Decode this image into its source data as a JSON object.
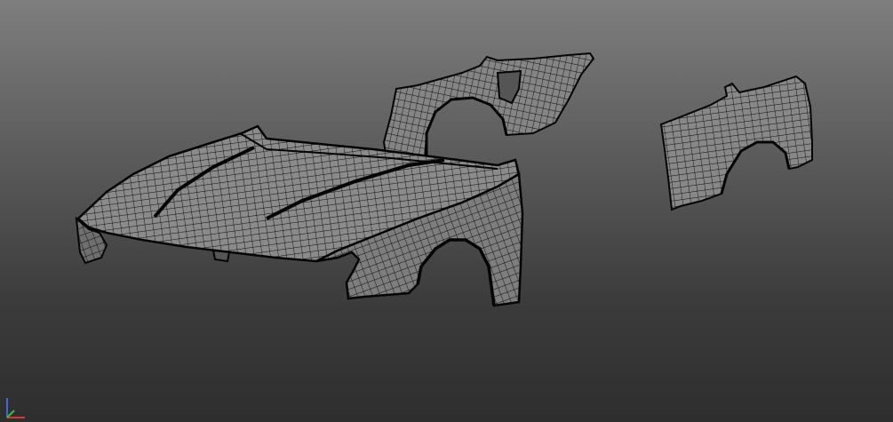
{
  "viewport": {
    "background_top": "#7e7e7e",
    "background_bottom": "#2e2e2e",
    "mesh_fill": "#8a8a8a",
    "mesh_fill_dark": "#6f6f6f",
    "wire_color": "#0a0a0a"
  },
  "scene": {
    "objects": [
      {
        "id": "hood-and-front-fenders"
      },
      {
        "id": "rear-quarter-panel"
      },
      {
        "id": "side-fender-panel"
      }
    ]
  },
  "axis_gizmo": {
    "icon": "axis-tripod-icon",
    "x_color": "#d23a2a",
    "y_color": "#3bbf3b",
    "z_color": "#3a6ad2"
  }
}
